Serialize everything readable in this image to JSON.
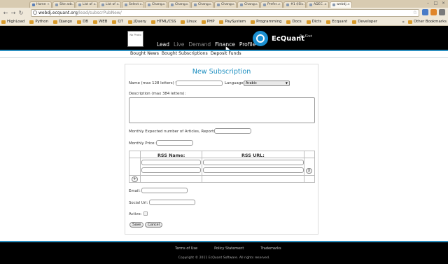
{
  "browser": {
    "tabs": [
      {
        "label": "Home",
        "active": false
      },
      {
        "label": "Site ad...",
        "active": false
      },
      {
        "label": "List of ...",
        "active": false
      },
      {
        "label": "List of ...",
        "active": false
      },
      {
        "label": "Select ...",
        "active": false
      },
      {
        "label": "Chang...",
        "active": false
      },
      {
        "label": "Chang...",
        "active": false
      },
      {
        "label": "Chang...",
        "active": false
      },
      {
        "label": "Chang...",
        "active": false
      },
      {
        "label": "Chang...",
        "active": false
      },
      {
        "label": "Prefer...",
        "active": false
      },
      {
        "label": "#1 (ISI...",
        "active": false
      },
      {
        "label": "ADEC ...",
        "active": false
      },
      {
        "label": "webdj...",
        "active": true
      }
    ],
    "url_host": "webdj.ecquant.org",
    "url_path": "/lead/subscrPubNew/",
    "bookmarks": [
      "HighLoad",
      "Python",
      "Django",
      "DB",
      "WEB",
      "QT",
      "JQuery",
      "HTML/CSS",
      "Linux",
      "PHP",
      "PaySystem",
      "Programming",
      "Docs",
      "Dicts",
      "Ecquant",
      "Developer"
    ],
    "bookmarks_more": "»",
    "other_bookmarks": "Other Bookmarks"
  },
  "header": {
    "avatar_text": "No Photo",
    "nav": [
      {
        "label": "Lead",
        "dim": false
      },
      {
        "label": "Live",
        "dim": true
      },
      {
        "label": "Demand",
        "dim": true
      },
      {
        "label": "Finance",
        "dim": false
      },
      {
        "label": "Profile",
        "dim": false
      }
    ],
    "brand": "EcQuant",
    "tagline": "Be First"
  },
  "subnav": [
    "Bought News",
    "Bought Subscriptions",
    "Deposit Funds"
  ],
  "form": {
    "title": "New Subscription",
    "name_label": "Name (max 128 letters) *:",
    "name_value": "",
    "language_label": "Language:",
    "language_value": "Arabic",
    "description_label": "Description (max 384 letters):",
    "articles_label": "Monthly Expected number of Articles, Reports:",
    "price_label": "Monthly Price:",
    "rss_name_header": "RSS Name:",
    "rss_url_header": "RSS URL:",
    "remove_row": "x",
    "add_row": "+",
    "email_label": "Email:",
    "social_label": "Social Url:",
    "active_label": "Active:",
    "save": "Save",
    "cancel": "Cancel"
  },
  "footer": {
    "links": [
      "Terms of Use",
      "Policy Statement",
      "Trademarks"
    ],
    "copyright": "Copyright © 2011 EcQuant Software. All rights reserved."
  },
  "colors": {
    "accent": "#2b8fc0",
    "title": "#1e8fc0",
    "header_bg": "#000000"
  }
}
